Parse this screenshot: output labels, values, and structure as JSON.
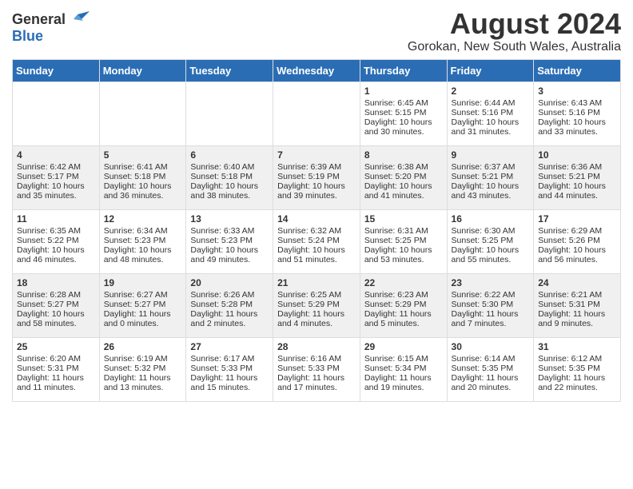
{
  "logo": {
    "general": "General",
    "blue": "Blue"
  },
  "title": "August 2024",
  "location": "Gorokan, New South Wales, Australia",
  "headers": [
    "Sunday",
    "Monday",
    "Tuesday",
    "Wednesday",
    "Thursday",
    "Friday",
    "Saturday"
  ],
  "rows": [
    [
      {
        "day": "",
        "info": ""
      },
      {
        "day": "",
        "info": ""
      },
      {
        "day": "",
        "info": ""
      },
      {
        "day": "",
        "info": ""
      },
      {
        "day": "1",
        "info": "Sunrise: 6:45 AM\nSunset: 5:15 PM\nDaylight: 10 hours and 30 minutes."
      },
      {
        "day": "2",
        "info": "Sunrise: 6:44 AM\nSunset: 5:16 PM\nDaylight: 10 hours and 31 minutes."
      },
      {
        "day": "3",
        "info": "Sunrise: 6:43 AM\nSunset: 5:16 PM\nDaylight: 10 hours and 33 minutes."
      }
    ],
    [
      {
        "day": "4",
        "info": "Sunrise: 6:42 AM\nSunset: 5:17 PM\nDaylight: 10 hours and 35 minutes."
      },
      {
        "day": "5",
        "info": "Sunrise: 6:41 AM\nSunset: 5:18 PM\nDaylight: 10 hours and 36 minutes."
      },
      {
        "day": "6",
        "info": "Sunrise: 6:40 AM\nSunset: 5:18 PM\nDaylight: 10 hours and 38 minutes."
      },
      {
        "day": "7",
        "info": "Sunrise: 6:39 AM\nSunset: 5:19 PM\nDaylight: 10 hours and 39 minutes."
      },
      {
        "day": "8",
        "info": "Sunrise: 6:38 AM\nSunset: 5:20 PM\nDaylight: 10 hours and 41 minutes."
      },
      {
        "day": "9",
        "info": "Sunrise: 6:37 AM\nSunset: 5:21 PM\nDaylight: 10 hours and 43 minutes."
      },
      {
        "day": "10",
        "info": "Sunrise: 6:36 AM\nSunset: 5:21 PM\nDaylight: 10 hours and 44 minutes."
      }
    ],
    [
      {
        "day": "11",
        "info": "Sunrise: 6:35 AM\nSunset: 5:22 PM\nDaylight: 10 hours and 46 minutes."
      },
      {
        "day": "12",
        "info": "Sunrise: 6:34 AM\nSunset: 5:23 PM\nDaylight: 10 hours and 48 minutes."
      },
      {
        "day": "13",
        "info": "Sunrise: 6:33 AM\nSunset: 5:23 PM\nDaylight: 10 hours and 49 minutes."
      },
      {
        "day": "14",
        "info": "Sunrise: 6:32 AM\nSunset: 5:24 PM\nDaylight: 10 hours and 51 minutes."
      },
      {
        "day": "15",
        "info": "Sunrise: 6:31 AM\nSunset: 5:25 PM\nDaylight: 10 hours and 53 minutes."
      },
      {
        "day": "16",
        "info": "Sunrise: 6:30 AM\nSunset: 5:25 PM\nDaylight: 10 hours and 55 minutes."
      },
      {
        "day": "17",
        "info": "Sunrise: 6:29 AM\nSunset: 5:26 PM\nDaylight: 10 hours and 56 minutes."
      }
    ],
    [
      {
        "day": "18",
        "info": "Sunrise: 6:28 AM\nSunset: 5:27 PM\nDaylight: 10 hours and 58 minutes."
      },
      {
        "day": "19",
        "info": "Sunrise: 6:27 AM\nSunset: 5:27 PM\nDaylight: 11 hours and 0 minutes."
      },
      {
        "day": "20",
        "info": "Sunrise: 6:26 AM\nSunset: 5:28 PM\nDaylight: 11 hours and 2 minutes."
      },
      {
        "day": "21",
        "info": "Sunrise: 6:25 AM\nSunset: 5:29 PM\nDaylight: 11 hours and 4 minutes."
      },
      {
        "day": "22",
        "info": "Sunrise: 6:23 AM\nSunset: 5:29 PM\nDaylight: 11 hours and 5 minutes."
      },
      {
        "day": "23",
        "info": "Sunrise: 6:22 AM\nSunset: 5:30 PM\nDaylight: 11 hours and 7 minutes."
      },
      {
        "day": "24",
        "info": "Sunrise: 6:21 AM\nSunset: 5:31 PM\nDaylight: 11 hours and 9 minutes."
      }
    ],
    [
      {
        "day": "25",
        "info": "Sunrise: 6:20 AM\nSunset: 5:31 PM\nDaylight: 11 hours and 11 minutes."
      },
      {
        "day": "26",
        "info": "Sunrise: 6:19 AM\nSunset: 5:32 PM\nDaylight: 11 hours and 13 minutes."
      },
      {
        "day": "27",
        "info": "Sunrise: 6:17 AM\nSunset: 5:33 PM\nDaylight: 11 hours and 15 minutes."
      },
      {
        "day": "28",
        "info": "Sunrise: 6:16 AM\nSunset: 5:33 PM\nDaylight: 11 hours and 17 minutes."
      },
      {
        "day": "29",
        "info": "Sunrise: 6:15 AM\nSunset: 5:34 PM\nDaylight: 11 hours and 19 minutes."
      },
      {
        "day": "30",
        "info": "Sunrise: 6:14 AM\nSunset: 5:35 PM\nDaylight: 11 hours and 20 minutes."
      },
      {
        "day": "31",
        "info": "Sunrise: 6:12 AM\nSunset: 5:35 PM\nDaylight: 11 hours and 22 minutes."
      }
    ]
  ]
}
